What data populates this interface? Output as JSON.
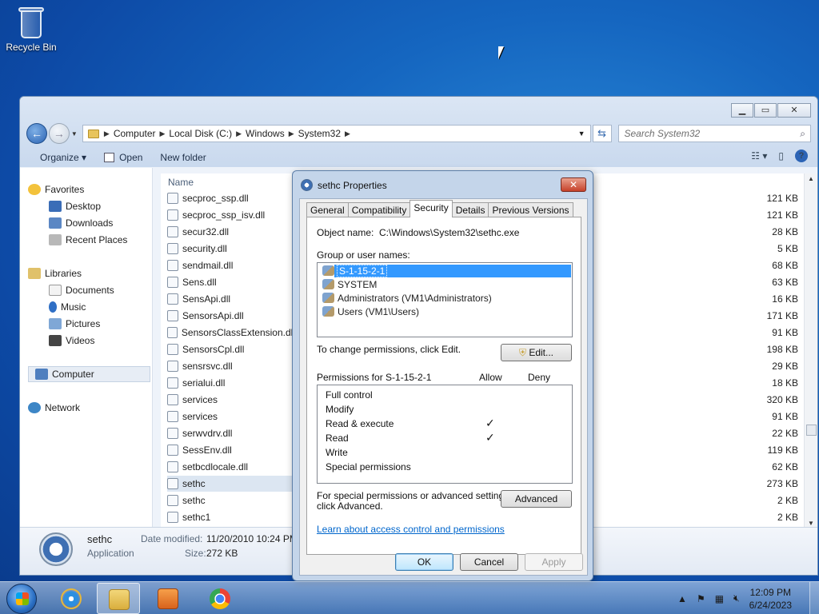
{
  "desktop": {
    "recycle_bin": "Recycle Bin"
  },
  "explorer": {
    "breadcrumbs": [
      "Computer",
      "Local Disk (C:)",
      "Windows",
      "System32"
    ],
    "search_placeholder": "Search System32",
    "toolbar": {
      "organize": "Organize ▾",
      "open": "Open",
      "new_folder": "New folder"
    },
    "nav": {
      "favorites": "Favorites",
      "desktop": "Desktop",
      "downloads": "Downloads",
      "recent": "Recent Places",
      "libraries": "Libraries",
      "documents": "Documents",
      "music": "Music",
      "pictures": "Pictures",
      "videos": "Videos",
      "computer": "Computer",
      "network": "Network"
    },
    "column_name": "Name",
    "files": [
      {
        "name": "secproc_ssp.dll",
        "size": "121 KB"
      },
      {
        "name": "secproc_ssp_isv.dll",
        "size": "121 KB"
      },
      {
        "name": "secur32.dll",
        "size": "28 KB"
      },
      {
        "name": "security.dll",
        "size": "5 KB"
      },
      {
        "name": "sendmail.dll",
        "size": "68 KB"
      },
      {
        "name": "Sens.dll",
        "size": "63 KB"
      },
      {
        "name": "SensApi.dll",
        "size": "16 KB"
      },
      {
        "name": "SensorsApi.dll",
        "size": "171 KB"
      },
      {
        "name": "SensorsClassExtension.dll",
        "size": "91 KB"
      },
      {
        "name": "SensorsCpl.dll",
        "size": "198 KB"
      },
      {
        "name": "sensrsvc.dll",
        "size": "29 KB"
      },
      {
        "name": "serialui.dll",
        "size": "18 KB"
      },
      {
        "name": "services",
        "size": "320 KB"
      },
      {
        "name": "services",
        "size": "91 KB"
      },
      {
        "name": "serwvdrv.dll",
        "size": "22 KB"
      },
      {
        "name": "SessEnv.dll",
        "size": "119 KB"
      },
      {
        "name": "setbcdlocale.dll",
        "size": "62 KB"
      },
      {
        "name": "sethc",
        "size": "273 KB"
      },
      {
        "name": "sethc",
        "size": "2 KB"
      },
      {
        "name": "sethc1",
        "size": "2 KB"
      }
    ],
    "details": {
      "name": "sethc",
      "type": "Application",
      "modified_label": "Date modified:",
      "modified_value": "11/20/2010 10:24 PM",
      "size_label": "Size:",
      "size_value": "272 KB"
    }
  },
  "dialog": {
    "title": "sethc Properties",
    "tabs": [
      "General",
      "Compatibility",
      "Security",
      "Details",
      "Previous Versions"
    ],
    "object_name_label": "Object name:",
    "object_name_value": "C:\\Windows\\System32\\sethc.exe",
    "group_label": "Group or user names:",
    "users": [
      "S-1-15-2-1",
      "SYSTEM",
      "Administrators (VM1\\Administrators)",
      "Users (VM1\\Users)"
    ],
    "change_text": "To change permissions, click Edit.",
    "edit_button": "Edit...",
    "perm_for": "Permissions for S-1-15-2-1",
    "allow": "Allow",
    "deny": "Deny",
    "permissions": [
      {
        "name": "Full control",
        "allow": ""
      },
      {
        "name": "Modify",
        "allow": ""
      },
      {
        "name": "Read & execute",
        "allow": "✓"
      },
      {
        "name": "Read",
        "allow": "✓"
      },
      {
        "name": "Write",
        "allow": ""
      },
      {
        "name": "Special permissions",
        "allow": ""
      }
    ],
    "special_text_1": "For special permissions or advanced settings,",
    "special_text_2": "click Advanced.",
    "advanced_button": "Advanced",
    "learn_link": "Learn about access control and permissions",
    "ok": "OK",
    "cancel": "Cancel",
    "apply": "Apply"
  },
  "taskbar": {
    "time": "12:09 PM",
    "date": "6/24/2023"
  }
}
